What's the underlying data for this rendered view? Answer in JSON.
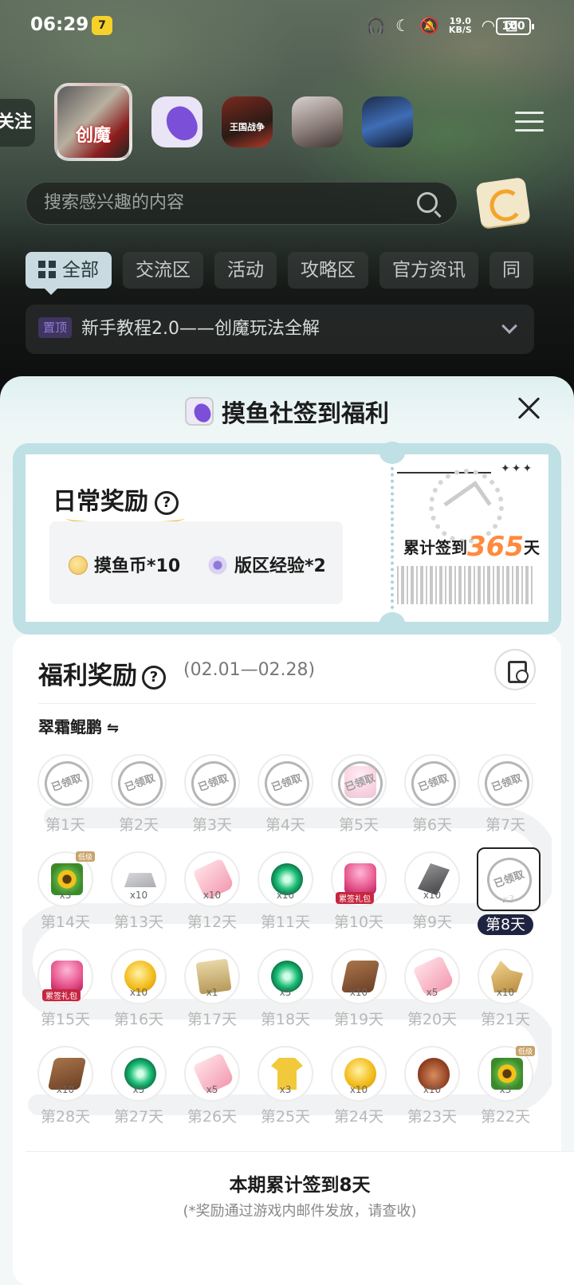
{
  "status_bar": {
    "time": "06:29",
    "net_speed": "19.0",
    "net_unit": "KB/S",
    "battery": "100"
  },
  "header": {
    "follow_label": "关注",
    "games": [
      {
        "name": "创魔",
        "selected": true
      },
      {
        "name": "摸鱼社",
        "selected": false
      },
      {
        "name": "王国战争",
        "selected": false
      },
      {
        "name": "anime-girl-game",
        "selected": false
      },
      {
        "name": "blue-creature-game",
        "selected": false
      }
    ],
    "search_placeholder": "搜索感兴趣的内容",
    "tabs": [
      "全部",
      "交流区",
      "活动",
      "攻略区",
      "官方资讯",
      "同"
    ],
    "active_tab": "全部",
    "pinned": {
      "badge": "置顶",
      "text": "新手教程2.0——创魔玩法全解"
    }
  },
  "sheet": {
    "title": "摸鱼社签到福利",
    "daily": {
      "title": "日常奖励",
      "rewards": [
        {
          "icon": "coin-icon",
          "label": "摸鱼币*10"
        },
        {
          "icon": "exp-icon",
          "label": "版区经验*2"
        }
      ],
      "cumulative_prefix": "累计签到",
      "cumulative_days": "365",
      "cumulative_suffix": "天"
    },
    "welfare": {
      "title": "福利奖励",
      "date_range": "(02.01—02.28)",
      "character": "翠霜鲲鹏",
      "swap_icon": "⇋",
      "claimed_text": "已领取",
      "rows": [
        [
          {
            "day": "第1天",
            "claimed": true,
            "icon": "claimed"
          },
          {
            "day": "第2天",
            "claimed": true,
            "icon": "claimed"
          },
          {
            "day": "第3天",
            "claimed": true,
            "icon": "claimed"
          },
          {
            "day": "第4天",
            "claimed": true,
            "icon": "claimed"
          },
          {
            "day": "第5天",
            "claimed": true,
            "icon": "gift-pack"
          },
          {
            "day": "第6天",
            "claimed": true,
            "icon": "claimed"
          },
          {
            "day": "第7天",
            "claimed": true,
            "icon": "claimed"
          }
        ],
        [
          {
            "day": "第14天",
            "qty": "x3",
            "icon": "sunflower-box",
            "badge": "低级"
          },
          {
            "day": "第13天",
            "qty": "x10",
            "icon": "silver-ingot"
          },
          {
            "day": "第12天",
            "qty": "x10",
            "icon": "pink-potion"
          },
          {
            "day": "第11天",
            "qty": "x10",
            "icon": "green-orb"
          },
          {
            "day": "第10天",
            "qty": "",
            "icon": "gift-pack",
            "tag": "累签礼包"
          },
          {
            "day": "第9天",
            "qty": "x10",
            "icon": "iron-ingot"
          },
          {
            "day": "第8天",
            "qty": "x3",
            "icon": "claimed",
            "claimed": true,
            "today": true
          }
        ],
        [
          {
            "day": "第15天",
            "qty": "",
            "icon": "gift-pack",
            "tag": "累签礼包"
          },
          {
            "day": "第16天",
            "qty": "x10",
            "icon": "gold-shell"
          },
          {
            "day": "第17天",
            "qty": "x1",
            "icon": "scroll"
          },
          {
            "day": "第18天",
            "qty": "x5",
            "icon": "green-orb"
          },
          {
            "day": "第19天",
            "qty": "x10",
            "icon": "leather"
          },
          {
            "day": "第20天",
            "qty": "x5",
            "icon": "pink-potion"
          },
          {
            "day": "第21天",
            "qty": "x10",
            "icon": "gold-ore"
          }
        ],
        [
          {
            "day": "第28天",
            "qty": "x10",
            "icon": "leather"
          },
          {
            "day": "第27天",
            "qty": "x5",
            "icon": "green-orb"
          },
          {
            "day": "第26天",
            "qty": "x5",
            "icon": "pink-potion"
          },
          {
            "day": "第25天",
            "qty": "x3",
            "icon": "gold-shirt"
          },
          {
            "day": "第24天",
            "qty": "x10",
            "icon": "gold-shell"
          },
          {
            "day": "第23天",
            "qty": "x10",
            "icon": "meat"
          },
          {
            "day": "第22天",
            "qty": "x3",
            "icon": "sunflower-box",
            "badge": "低级"
          }
        ]
      ],
      "footer_main": "本期累计签到8天",
      "footer_sub": "(*奖励通过游戏内邮件发放，请查收)"
    }
  }
}
